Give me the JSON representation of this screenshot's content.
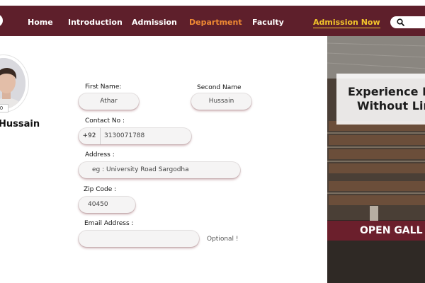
{
  "nav": {
    "items": [
      {
        "label": "Home",
        "active": false
      },
      {
        "label": "Introduction",
        "active": false
      },
      {
        "label": "Admission",
        "active": false
      },
      {
        "label": "Department",
        "active": true
      },
      {
        "label": "Faculty",
        "active": false
      }
    ],
    "cta_label": "Admission Now",
    "search_icon": "search-icon"
  },
  "profile": {
    "name": "Hussain",
    "badge": "0"
  },
  "form": {
    "first_name": {
      "label": "First Name:",
      "value": "Athar"
    },
    "second_name": {
      "label": "Second Name",
      "value": "Hussain"
    },
    "contact": {
      "label": "Contact No :",
      "prefix": "+92",
      "value": "3130071788"
    },
    "address": {
      "label": "Address :",
      "placeholder": "eg : University Road Sargodha"
    },
    "zip": {
      "label": "Zip Code :",
      "value": "40450"
    },
    "email": {
      "label": "Email Address :",
      "value": "",
      "note": "Optional !"
    }
  },
  "hero": {
    "line1": "Experience L",
    "line2": "Without Lin",
    "button": "OPEN GALL"
  },
  "colors": {
    "brand": "#5e1f2b",
    "active_nav": "#f08a33",
    "cta": "#f3c52a",
    "gallery_button": "#6b1f2c"
  }
}
